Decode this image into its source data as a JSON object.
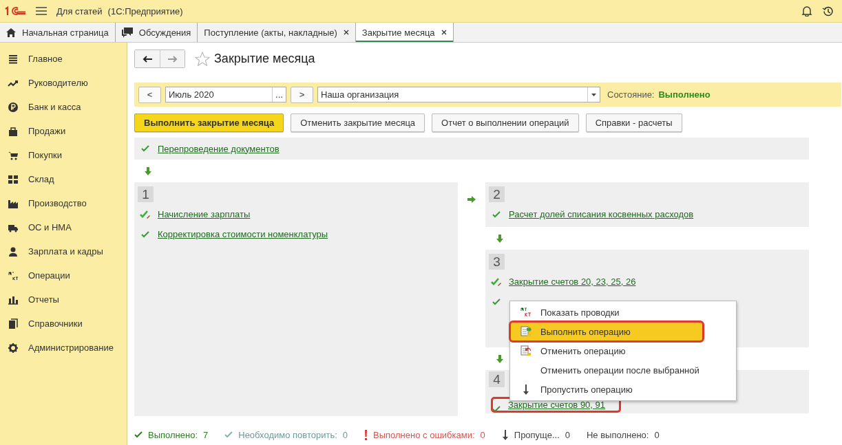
{
  "app": {
    "title": "Для статей",
    "subtitle": "(1С:Предприятие)"
  },
  "tabs": [
    {
      "label": "Начальная страница",
      "closable": false,
      "selected": false
    },
    {
      "label": "Обсуждения",
      "closable": false,
      "selected": false
    },
    {
      "label": "Поступление (акты, накладные)",
      "closable": true,
      "selected": false
    },
    {
      "label": "Закрытие месяца",
      "closable": true,
      "selected": true
    }
  ],
  "sidebar": {
    "items": [
      {
        "label": "Главное"
      },
      {
        "label": "Руководителю"
      },
      {
        "label": "Банк и касса"
      },
      {
        "label": "Продажи"
      },
      {
        "label": "Покупки"
      },
      {
        "label": "Склад"
      },
      {
        "label": "Производство"
      },
      {
        "label": "ОС и НМА"
      },
      {
        "label": "Зарплата и кадры"
      },
      {
        "label": "Операции"
      },
      {
        "label": "Отчеты"
      },
      {
        "label": "Справочники"
      },
      {
        "label": "Администрирование"
      }
    ]
  },
  "page": {
    "title": "Закрытие месяца",
    "favorite": false
  },
  "filter": {
    "prev": "<",
    "period": "Июль 2020",
    "choose": "...",
    "next": ">",
    "organization": "Наша организация",
    "state_label": "Состояние:",
    "state_value": "Выполнено"
  },
  "actions": [
    {
      "label": "Выполнить закрытие месяца",
      "primary": true
    },
    {
      "label": "Отменить закрытие месяца",
      "primary": false
    },
    {
      "label": "Отчет о выполнении операций",
      "primary": false
    },
    {
      "label": "Справки - расчеты",
      "primary": false
    }
  ],
  "first_step": {
    "label": "Перепроведение документов",
    "kind": "done"
  },
  "groups": [
    {
      "number": "1",
      "items": [
        {
          "label": "Начисление зарплаты",
          "kind": "edited"
        },
        {
          "label": "Корректировка стоимости номенклатуры",
          "kind": "done"
        }
      ]
    },
    {
      "number": "2",
      "items": [
        {
          "label": "Расчет долей списания косвенных расходов",
          "kind": "done"
        }
      ]
    },
    {
      "number": "3",
      "items": [
        {
          "label": "Закрытие счетов 20, 23, 25, 26",
          "kind": "edited"
        },
        {
          "kind": "done"
        }
      ]
    },
    {
      "number": "4",
      "items": [
        {
          "label": "Закрытие счетов 90, 91",
          "kind": "done",
          "highlighted": true
        }
      ]
    }
  ],
  "context_menu": [
    {
      "label": "Показать проводки",
      "selected": false,
      "highlighted": false
    },
    {
      "label": "Выполнить операцию",
      "selected": true,
      "highlighted": true
    },
    {
      "label": "Отменить операцию",
      "selected": false,
      "highlighted": false
    },
    {
      "label": "Отменить операции после выбранной",
      "selected": false,
      "highlighted": false
    },
    {
      "label": "Пропустить операцию",
      "selected": false,
      "highlighted": false
    }
  ],
  "summary": [
    {
      "kind": "done",
      "label": "Выполнено:",
      "count": "7"
    },
    {
      "kind": "repeat",
      "label": "Необходимо повторить:",
      "count": "0"
    },
    {
      "kind": "error",
      "label": "Выполнено с ошибками:",
      "count": "0"
    },
    {
      "kind": "skipped",
      "label": "Пропуще...",
      "count": "0"
    },
    {
      "kind": "not-done",
      "label": "Не выполнено:",
      "count": "0"
    }
  ]
}
